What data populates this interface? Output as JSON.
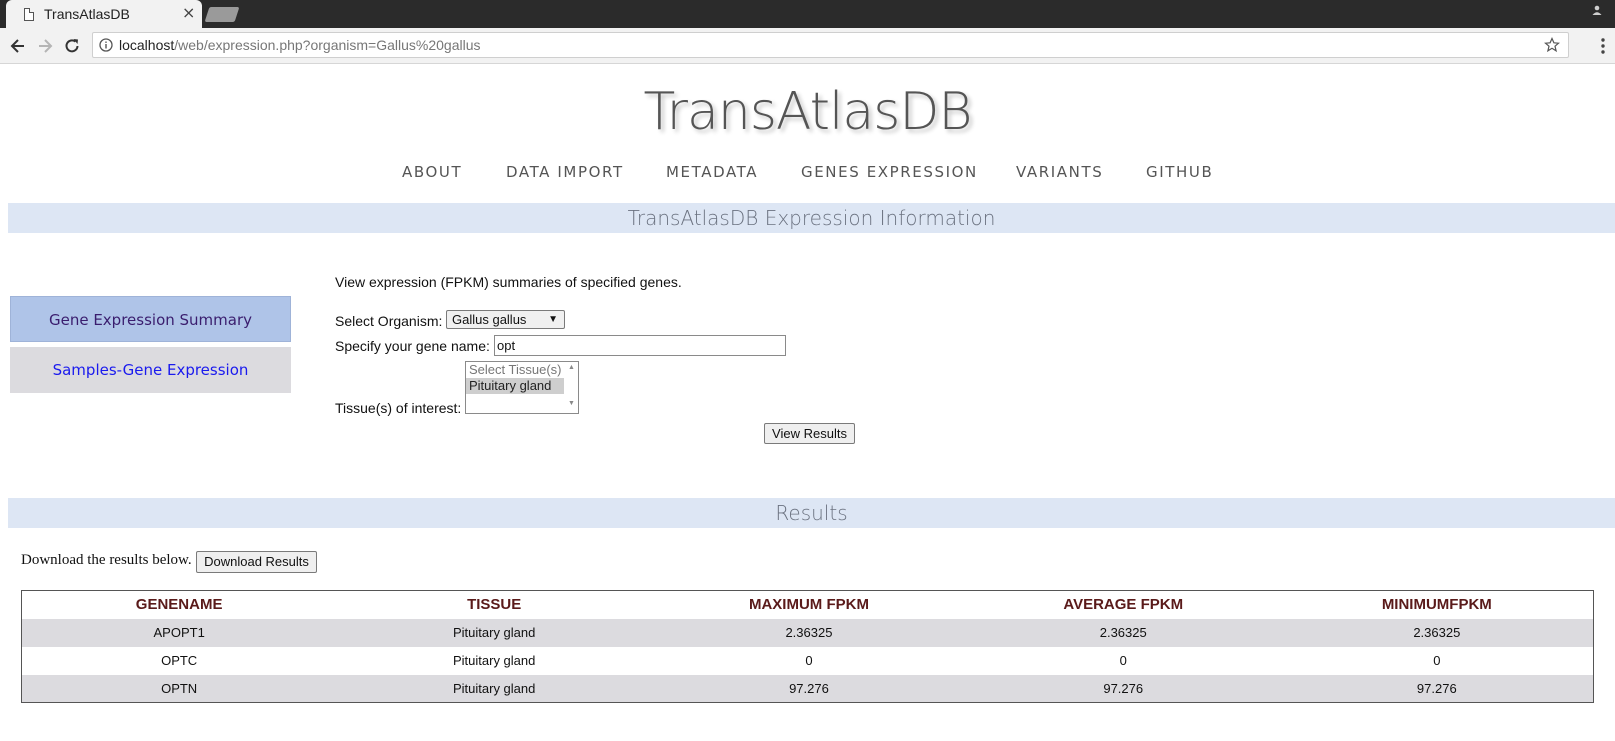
{
  "browser": {
    "tab_title": "TransAtlasDB",
    "tab_close": "×",
    "url_host": "localhost",
    "url_path": "/web/expression.php?organism=Gallus%20gallus"
  },
  "site": {
    "logo": "TransAtlasDB",
    "nav": [
      "ABOUT",
      "DATA IMPORT",
      "METADATA",
      "GENES EXPRESSION",
      "VARIANTS",
      "GITHUB"
    ]
  },
  "page": {
    "section_title": "TransAtlasDB Expression Information",
    "results_title": "Results"
  },
  "side_menu": [
    {
      "label": "Gene Expression Summary",
      "active": true
    },
    {
      "label": "Samples-Gene Expression",
      "active": false
    }
  ],
  "form": {
    "intro": "View expression (FPKM) summaries of specified genes.",
    "organism_label": "Select Organism:",
    "organism_value": "Gallus gallus",
    "gene_label": "Specify your gene name:",
    "gene_value": "opt",
    "tissue_label": "Tissue(s) of interest:",
    "tissue_options": [
      "Select Tissue(s)",
      "Pituitary gland"
    ],
    "view_button": "View Results"
  },
  "download": {
    "text": "Download the results below.",
    "button": "Download Results"
  },
  "results_table": {
    "columns": [
      "GENENAME",
      "TISSUE",
      "MAXIMUM FPKM",
      "AVERAGE FPKM",
      "MINIMUMFPKM"
    ],
    "rows": [
      [
        "APOPT1",
        "Pituitary gland",
        "2.36325",
        "2.36325",
        "2.36325"
      ],
      [
        "OPTC",
        "Pituitary gland",
        "0",
        "0",
        "0"
      ],
      [
        "OPTN",
        "Pituitary gland",
        "97.276",
        "97.276",
        "97.276"
      ]
    ]
  }
}
